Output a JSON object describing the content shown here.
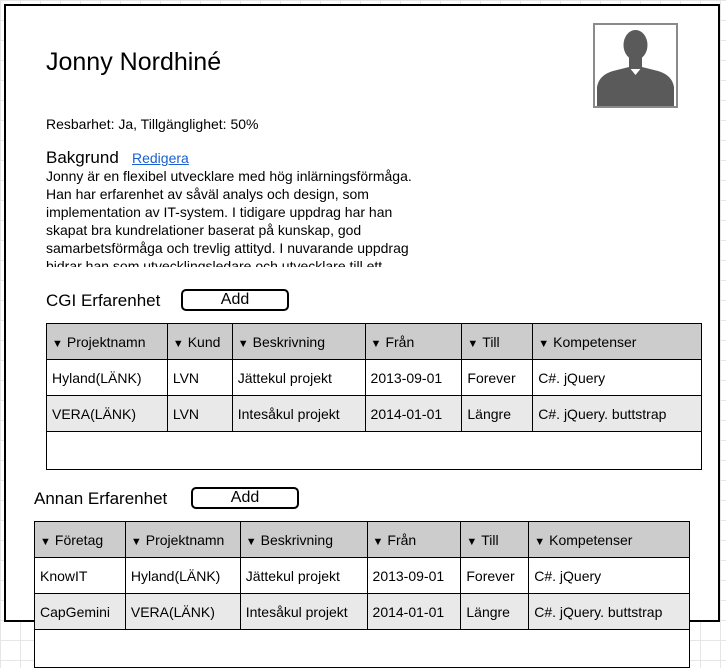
{
  "profile": {
    "name": "Jonny Nordhiné",
    "availability": "Resbarhet: Ja, Tillgänglighet: 50%",
    "background_title": "Bakgrund",
    "edit_label": "Redigera",
    "bio": "Jonny är en flexibel utvecklare med hög inlärningsförmåga. Han har erfarenhet av såväl analys och design, som implementation av IT-system. I tidigare uppdrag har han skapat bra kundrelationer baserat på kunskap, god samarbetsförmåga och trevlig attityd. I nuvarande uppdrag bidrar han som utvecklingsledare och utvecklare till ett"
  },
  "cgi": {
    "title": "CGI Erfarenhet",
    "add_label": "Add",
    "columns": [
      "Projektnamn",
      "Kund",
      "Beskrivning",
      "Från",
      "Till",
      "Kompetenser"
    ],
    "rows": [
      [
        "Hyland(LÄNK)",
        "LVN",
        "Jättekul projekt",
        "2013-09-01",
        "Forever",
        "C#. jQuery"
      ],
      [
        "VERA(LÄNK)",
        "LVN",
        "Intesåkul projekt",
        "2014-01-01",
        "Längre",
        "C#. jQuery. buttstrap"
      ]
    ]
  },
  "other": {
    "title": "Annan Erfarenhet",
    "add_label": "Add",
    "columns": [
      "Företag",
      "Projektnamn",
      "Beskrivning",
      "Från",
      "Till",
      "Kompetenser"
    ],
    "rows": [
      [
        "KnowIT",
        "Hyland(LÄNK)",
        "Jättekul projekt",
        "2013-09-01",
        "Forever",
        "C#. jQuery"
      ],
      [
        "CapGemini",
        "VERA(LÄNK)",
        "Intesåkul projekt",
        "2014-01-01",
        "Längre",
        "C#. jQuery. buttstrap"
      ]
    ]
  },
  "colors": {
    "header_bg": "#cccccc",
    "alt_row_bg": "#e9e9e9",
    "link": "#1a5fd0",
    "avatar": "#5a5a5a"
  },
  "icons": {
    "sort": "sort-down-icon",
    "avatar": "user-silhouette-icon"
  }
}
